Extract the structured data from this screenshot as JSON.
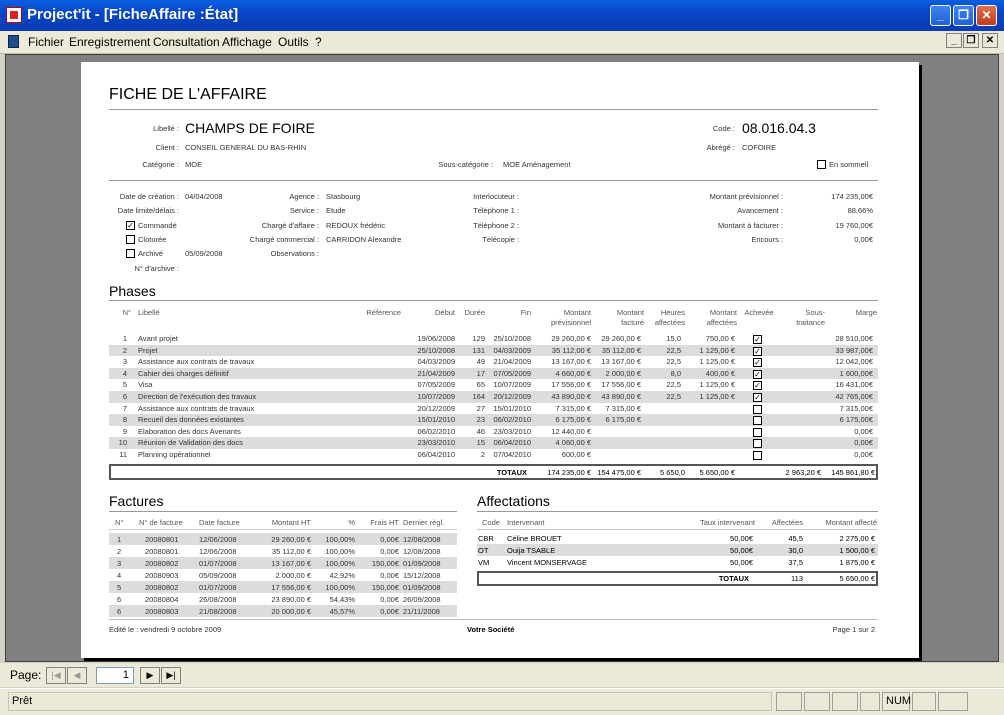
{
  "window": {
    "title": "Project'it - [FicheAffaire :État]",
    "buttons": [
      "_",
      "❐",
      "✕"
    ]
  },
  "menu": [
    "Fichier",
    "Enregistrement",
    "Consultation",
    "Affichage",
    "Outils",
    "?"
  ],
  "report": {
    "title": "FICHE DE L'AFFAIRE",
    "libelle_label": "Libellé :",
    "libelle": "CHAMPS DE FOIRE",
    "client_label": "Client :",
    "client": "CONSEIL GENERAL DU BAS-RHIN",
    "categorie_label": "Catégorie :",
    "categorie": "MOE",
    "souscategorie_label": "Sous-catégorie :",
    "souscategorie": "MOE Aménagement",
    "code_label": "Code :",
    "code": "08.016.04.3",
    "abrege_label": "Abrégé :",
    "abrege": "COFOIRE",
    "sommeil_label": "En sommeil",
    "left": [
      {
        "label": "Date de création :",
        "value": "04/04/2008"
      },
      {
        "label": "Date limite/délais :",
        "value": ""
      }
    ],
    "commande": "Commandé",
    "cloturee": "Cloturée",
    "archive": "Archivé",
    "archive_date": "05/09/2008",
    "num_archive": "N° d'archive :",
    "mid_labels": [
      "Agence :",
      "Service :",
      "Chargé d'affaire :",
      "Chargé commercial :",
      "Observations :"
    ],
    "mid_values": [
      "Stasbourg",
      "Etude",
      "REDOUX frédéric",
      "CARRIDON Alexandre",
      ""
    ],
    "contact_labels": [
      "Interlocuteur :",
      "Téléphone 1 :",
      "Téléphone 2 :",
      "Télécopie :"
    ],
    "money_labels": [
      "Montant prévisionnel :",
      "Avancement :",
      "Montant à facturer :",
      "Encours :"
    ],
    "money_values": [
      "174 235,00€",
      "88,66%",
      "19 760,00€",
      "0,00€"
    ],
    "phases_title": "Phases",
    "phases_headers": [
      "N°",
      "Libellé",
      "Référence",
      "Début",
      "Durée",
      "Fin",
      "Montant prévisionnel",
      "Montant facturé",
      "Heures affectées",
      "Montant affectées",
      "Achevée",
      "Sous-traitance",
      "Marge"
    ],
    "phases": [
      [
        "1",
        "Avant projet",
        "19/06/2008",
        "129",
        "25/10/2008",
        "29 260,00 €",
        "29 260,00 €",
        "15,0",
        "750,00 €",
        true,
        "28 510,00€"
      ],
      [
        "2",
        "Projet",
        "25/10/2008",
        "131",
        "04/03/2009",
        "35 112,00 €",
        "35 112,00 €",
        "22,5",
        "1 125,00 €",
        true,
        "33 987,00€"
      ],
      [
        "3",
        "Assistance aux contrats de travaux",
        "04/03/2009",
        "49",
        "21/04/2009",
        "13 167,00 €",
        "13 167,00 €",
        "22,5",
        "1 125,00 €",
        true,
        "12 042,00€"
      ],
      [
        "4",
        "Cahier des charges définitif",
        "21/04/2009",
        "17",
        "07/05/2009",
        "4 660,00 €",
        "2 000,00 €",
        "8,0",
        "400,00 €",
        true,
        "1 600,00€"
      ],
      [
        "5",
        "Visa",
        "07/05/2009",
        "65",
        "10/07/2009",
        "17 556,00 €",
        "17 556,00 €",
        "22,5",
        "1 125,00 €",
        true,
        "16 431,00€"
      ],
      [
        "6",
        "Direction de l'exécution des travaux",
        "10/07/2009",
        "164",
        "20/12/2009",
        "43 890,00 €",
        "43 890,00 €",
        "22,5",
        "1 125,00 €",
        true,
        "42 765,00€"
      ],
      [
        "7",
        "Assistance aux contrats de travaux",
        "20/12/2009",
        "27",
        "15/01/2010",
        "7 315,00 €",
        "7 315,00 €",
        "",
        "",
        false,
        "7 315,00€"
      ],
      [
        "8",
        "Recueil des données existantes",
        "15/01/2010",
        "23",
        "06/02/2010",
        "6 175,00 €",
        "6 175,00 €",
        "",
        "",
        false,
        "6 175,00€"
      ],
      [
        "9",
        "Elaboration des docs Avenants",
        "06/02/2010",
        "46",
        "23/03/2010",
        "12 440,00 €",
        "",
        "",
        "",
        false,
        "0,00€"
      ],
      [
        "10",
        "Réunion de Validation des docs",
        "23/03/2010",
        "15",
        "06/04/2010",
        "4 060,00 €",
        "",
        "",
        "",
        false,
        "0,00€"
      ],
      [
        "11",
        "Planning opérationnel",
        "06/04/2010",
        "2",
        "07/04/2010",
        "600,00 €",
        "",
        "",
        "",
        false,
        "0,00€"
      ]
    ],
    "phases_totals": [
      "TOTAUX",
      "174 235,00 €",
      "154 475,00 €",
      "5 650,0",
      "5 650,00 €",
      "2 963,20 €",
      "145 861,80 €"
    ],
    "factures_title": "Factures",
    "factures_headers": [
      "N°",
      "N° de facture",
      "Date facture",
      "Montant HT",
      "%",
      "Frais HT",
      "Dernier règl."
    ],
    "factures": [
      [
        "1",
        "20080801",
        "12/06/2008",
        "29 260,00 €",
        "100,00%",
        "0,00€",
        "12/08/2008"
      ],
      [
        "2",
        "20080801",
        "12/06/2008",
        "35 112,00 €",
        "100,00%",
        "0,00€",
        "12/08/2008"
      ],
      [
        "3",
        "20080802",
        "01/07/2008",
        "13 167,00 €",
        "100,00%",
        "150,00€",
        "01/09/2008"
      ],
      [
        "4",
        "20080903",
        "05/09/2008",
        "2 000,00 €",
        "42,92%",
        "0,00€",
        "15/12/2008"
      ],
      [
        "5",
        "20080802",
        "01/07/2008",
        "17 556,00 €",
        "100,00%",
        "150,00€",
        "01/09/2008"
      ],
      [
        "6",
        "20080804",
        "26/08/2008",
        "23 890,00 €",
        "54,43%",
        "0,00€",
        "26/09/2008"
      ],
      [
        "6",
        "20080803",
        "21/08/2008",
        "20 000,00 €",
        "45,57%",
        "0,00€",
        "21/11/2008"
      ]
    ],
    "affect_title": "Affectations",
    "affect_headers": [
      "Code",
      "Intervenant",
      "Taux intervenant",
      "Affectées",
      "Montant affecté"
    ],
    "affect": [
      [
        "CBR",
        "Céline BROUET",
        "50,00€",
        "45,5",
        "2 275,00 €"
      ],
      [
        "OT",
        "Ouija TSABLE",
        "50,00€",
        "30,0",
        "1 500,00 €"
      ],
      [
        "VM",
        "Vincent MONSERVAGE",
        "50,00€",
        "37,5",
        "1 875,00 €"
      ]
    ],
    "affect_totals": [
      "TOTAUX",
      "113",
      "5 650,00 €"
    ],
    "footer_left": "Edité le : vendredi 9 octobre 2009",
    "footer_mid": "Votre Société",
    "footer_right": "Page 1 sur 2"
  },
  "nav": {
    "label": "Page:",
    "page": "1"
  },
  "status": {
    "text": "Prêt",
    "num": "NUM"
  }
}
